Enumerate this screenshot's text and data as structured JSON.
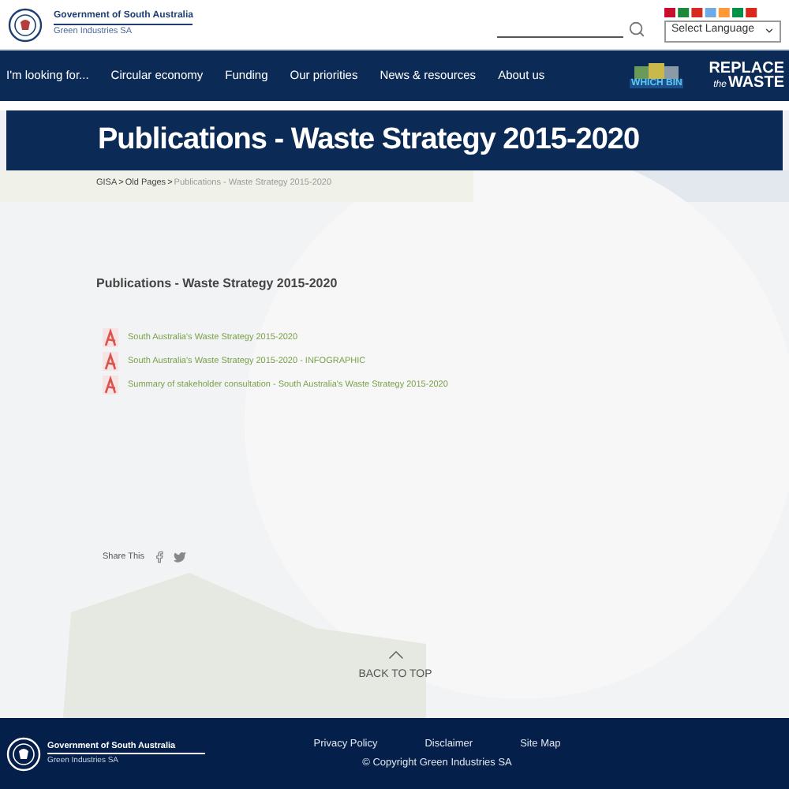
{
  "header": {
    "gov_title": "Government of South Australia",
    "agency": "Green Industries SA",
    "language_select": "Select Language"
  },
  "nav": {
    "items": [
      "I'm looking for...",
      "Circular economy",
      "Funding",
      "Our priorities",
      "News & resources",
      "About us"
    ],
    "which_bin": "WHICH BIN",
    "replace": {
      "line1": "REPLACE",
      "the": "the",
      "line2": "WASTE"
    }
  },
  "page_title": "Publications - Waste Strategy 2015-2020",
  "breadcrumb": [
    {
      "label": "GISA",
      "current": false
    },
    {
      "label": "Old Pages",
      "current": false
    },
    {
      "label": "Publications - Waste Strategy 2015-2020",
      "current": true
    }
  ],
  "separator": ">",
  "heading": "Publications - Waste Strategy 2015-2020",
  "documents": [
    "South Australia's Waste Strategy 2015-2020",
    "South Australia's Waste Strategy 2015-2020 - INFOGRAPHIC",
    "Summary of stakeholder consultation - South Australia's Waste Strategy 2015-2020"
  ],
  "share_label": "Share This",
  "back_to_top": "BACK TO TOP",
  "footer": {
    "gov_title": "Government of South Australia",
    "agency": "Green Industries SA",
    "links": [
      "Privacy Policy",
      "Disclaimer",
      "Site Map"
    ],
    "copyright": "© Copyright Green Industries SA"
  }
}
